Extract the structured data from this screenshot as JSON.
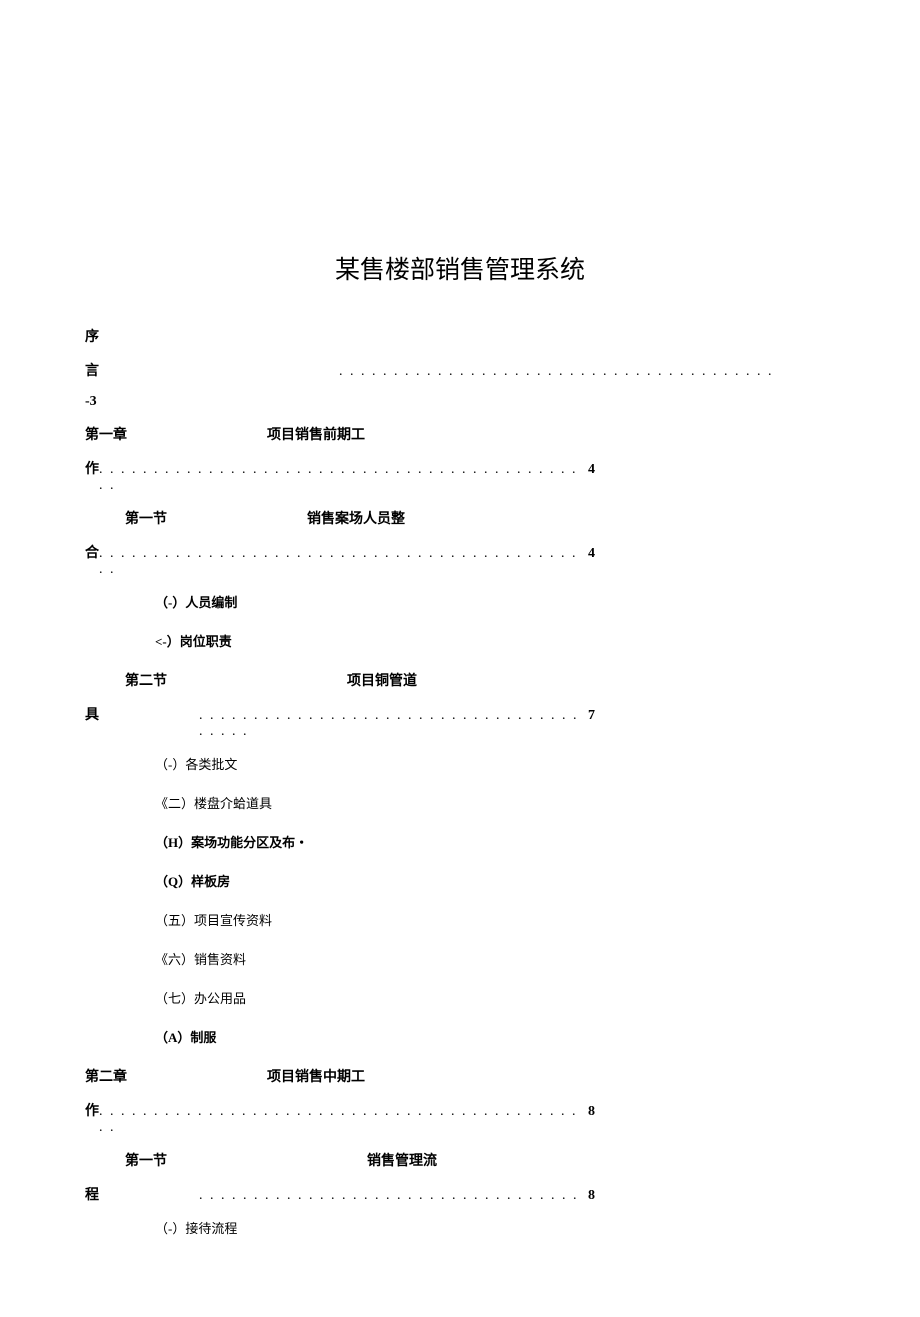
{
  "title": "某售楼部销售管理系统",
  "toc": {
    "preface_1": "序",
    "preface_2": "言",
    "preface_3": "-3",
    "ch1_label": "第一章",
    "ch1_title": "项目销售前期工",
    "ch1_cont": "作",
    "ch1_page": "4",
    "ch1_s1_label": "第一节",
    "ch1_s1_title": "销售案场人员整",
    "ch1_s1_cont": "合",
    "ch1_s1_page": "4",
    "ch1_s1_i1": "（-）人员编制",
    "ch1_s1_i2": "<-）岗位职责",
    "ch1_s2_label": "第二节",
    "ch1_s2_title": "项目铜管道",
    "ch1_s2_cont": "具",
    "ch1_s2_page": "7",
    "ch1_s2_i1": "（-）各类批文",
    "ch1_s2_i2": "《二）楼盘介蛤道具",
    "ch1_s2_i3": "（H）案场功能分区及布・",
    "ch1_s2_i4": "（Q）样板房",
    "ch1_s2_i5": "（五）项目宣传资料",
    "ch1_s2_i6": "《六）销售资料",
    "ch1_s2_i7": "（七）办公用品",
    "ch1_s2_i8": "（A）制服",
    "ch2_label": "第二章",
    "ch2_title": "项目销售中期工",
    "ch2_cont": "作",
    "ch2_page": "8",
    "ch2_s1_label": "第一节",
    "ch2_s1_title": "销售管理流",
    "ch2_s1_cont": "程",
    "ch2_s1_page": "8",
    "ch2_s1_i1": "（-）接待流程"
  },
  "dots_long": ". . . . . . . . . . . . . . . . . . . . . . . . . . . . . . . . . . . . . . . . . . . . . .",
  "dots_med": ". . . . . . . . . . . . . . . . . . . . . . . . . . . . . . . . . . . . . . . .",
  "dots_short": ". . . . . . . . . . . . . . . . . . . . . . . . . . . . . . . . . . ."
}
